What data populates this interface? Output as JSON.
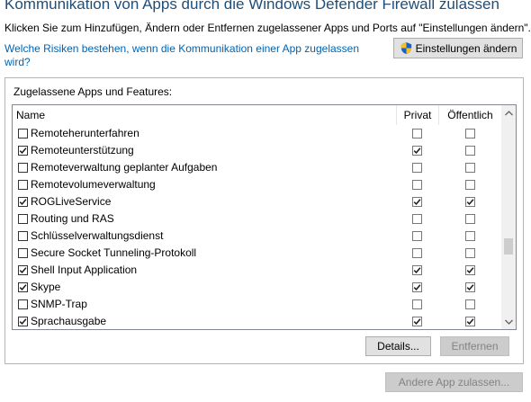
{
  "header": {
    "title": "Kommunikation von Apps durch die Windows Defender Firewall zulassen",
    "subtitle": "Klicken Sie zum Hinzufügen, Ändern oder Entfernen zugelassener Apps und Ports auf \"Einstellungen ändern\".",
    "risk_link": "Welche Risiken bestehen, wenn die Kommunikation einer App zugelassen wird?",
    "change_settings_label": "Einstellungen ändern"
  },
  "panel": {
    "label": "Zugelassene Apps und Features:",
    "columns": {
      "name": "Name",
      "private": "Privat",
      "public": "Öffentlich"
    },
    "rows": [
      {
        "label": "Remoteherunterfahren",
        "enabled": false,
        "private": false,
        "public": false
      },
      {
        "label": "Remoteunterstützung",
        "enabled": true,
        "private": true,
        "public": false
      },
      {
        "label": "Remoteverwaltung geplanter Aufgaben",
        "enabled": false,
        "private": false,
        "public": false
      },
      {
        "label": "Remotevolumeverwaltung",
        "enabled": false,
        "private": false,
        "public": false
      },
      {
        "label": "ROGLiveService",
        "enabled": true,
        "private": true,
        "public": true
      },
      {
        "label": "Routing und RAS",
        "enabled": false,
        "private": false,
        "public": false
      },
      {
        "label": "Schlüsselverwaltungsdienst",
        "enabled": false,
        "private": false,
        "public": false
      },
      {
        "label": "Secure Socket Tunneling-Protokoll",
        "enabled": false,
        "private": false,
        "public": false
      },
      {
        "label": "Shell Input Application",
        "enabled": true,
        "private": true,
        "public": true
      },
      {
        "label": "Skype",
        "enabled": true,
        "private": true,
        "public": true
      },
      {
        "label": "SNMP-Trap",
        "enabled": false,
        "private": false,
        "public": false
      },
      {
        "label": "Sprachausgabe",
        "enabled": true,
        "private": true,
        "public": true
      }
    ],
    "details_label": "Details...",
    "remove_label": "Entfernen"
  },
  "footer": {
    "add_app_label": "Andere App zulassen..."
  },
  "colors": {
    "title": "#1e4e79",
    "link": "#0063b1",
    "button_bg": "#e1e1e1",
    "disabled_text": "#838383"
  },
  "icons": {
    "settings_button": "uac-shield-icon",
    "scroll_up": "scroll-up-arrow-icon",
    "scroll_down": "scroll-down-arrow-icon",
    "check": "checkmark-icon"
  }
}
